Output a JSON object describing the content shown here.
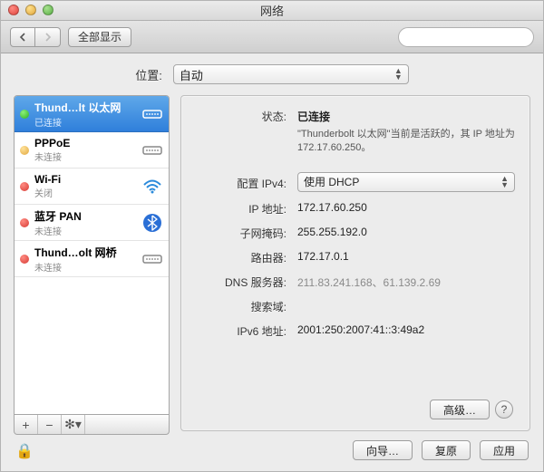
{
  "window": {
    "title": "网络"
  },
  "toolbar": {
    "show_all": "全部显示",
    "search_placeholder": ""
  },
  "location": {
    "label": "位置:",
    "value": "自动"
  },
  "sidebar": {
    "items": [
      {
        "name": "Thund…lt 以太网",
        "sub": "已连接",
        "dot": "green",
        "icon": "ethernet"
      },
      {
        "name": "PPPoE",
        "sub": "未连接",
        "dot": "amber",
        "icon": "ethernet"
      },
      {
        "name": "Wi-Fi",
        "sub": "关闭",
        "dot": "red",
        "icon": "wifi"
      },
      {
        "name": "蓝牙 PAN",
        "sub": "未连接",
        "dot": "red",
        "icon": "bluetooth"
      },
      {
        "name": "Thund…olt 网桥",
        "sub": "未连接",
        "dot": "red",
        "icon": "ethernet"
      }
    ],
    "bar": {
      "add": "+",
      "remove": "−",
      "gear": "✻▾"
    }
  },
  "details": {
    "status_label": "状态:",
    "status_value": "已连接",
    "status_desc": "\"Thunderbolt 以太网\"当前是活跃的，其 IP 地址为 172.17.60.250。",
    "config_label": "配置 IPv4:",
    "config_value": "使用 DHCP",
    "ip_label": "IP 地址:",
    "ip_value": "172.17.60.250",
    "mask_label": "子网掩码:",
    "mask_value": "255.255.192.0",
    "router_label": "路由器:",
    "router_value": "172.17.0.1",
    "dns_label": "DNS 服务器:",
    "dns_value": "211.83.241.168、61.139.2.69",
    "search_label": "搜索域:",
    "search_value": "",
    "ipv6_label": "IPv6 地址:",
    "ipv6_value": "2001:250:2007:41::3:49a2",
    "advanced": "高级…"
  },
  "footer": {
    "wizard": "向导…",
    "revert": "复原",
    "apply": "应用"
  }
}
